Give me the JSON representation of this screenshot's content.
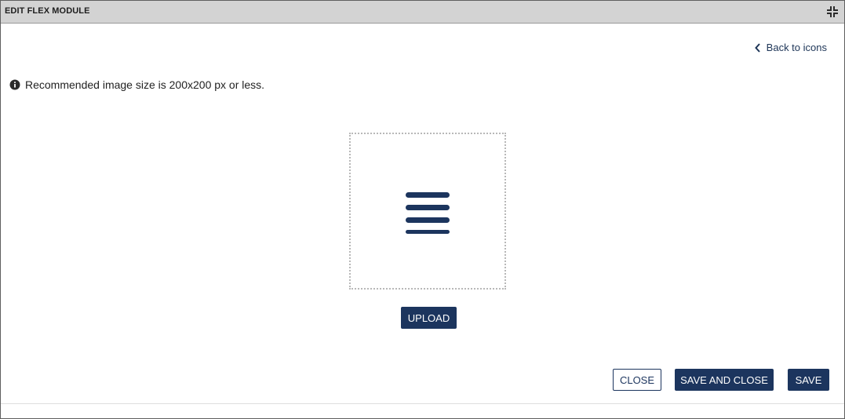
{
  "dialog": {
    "title": "EDIT FLEX MODULE",
    "collapse_icon": "collapse-arrows-icon"
  },
  "back_link": {
    "label": "Back to icons",
    "icon": "chevron-left-icon"
  },
  "info": {
    "icon": "info-circle-icon",
    "text": "Recommended image size is 200x200 px or less."
  },
  "preview": {
    "icon": "hamburger-menu-icon",
    "icon_color": "#1c355e"
  },
  "upload_button": {
    "label": "UPLOAD"
  },
  "footer": {
    "close_label": "CLOSE",
    "save_and_close_label": "SAVE AND CLOSE",
    "save_label": "SAVE"
  },
  "colors": {
    "primary": "#1c355e",
    "titlebar_bg": "#d3d3d3"
  }
}
